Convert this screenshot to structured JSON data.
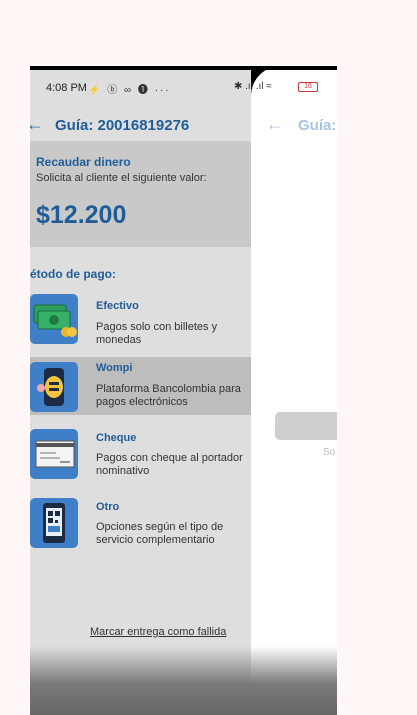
{
  "status": {
    "time": "4:08 PM",
    "icons_left": "⚡ ⓑ ∞ ❶ ···",
    "icons_right": "✱ .ıl .ıl ≈",
    "battery": "16"
  },
  "header": {
    "title": "Guía: 20016819276"
  },
  "amount": {
    "title": "Recaudar dinero",
    "subtitle": "Solicita al cliente el siguiente valor:",
    "value": "$12.200"
  },
  "payment": {
    "section_title": "étodo de pago:",
    "methods": [
      {
        "name": "Efectivo",
        "desc": "Pagos solo con billetes y monedas",
        "icon": "cash-icon"
      },
      {
        "name": "Wompi",
        "desc": "Plataforma Bancolombia para pagos electrónicos",
        "icon": "wompi-phone-icon"
      },
      {
        "name": "Cheque",
        "desc": "Pagos con cheque al portador nominativo",
        "icon": "cheque-icon"
      },
      {
        "name": "Otro",
        "desc": "Opciones según el tipo de servicio complementario",
        "icon": "qr-phone-icon"
      }
    ]
  },
  "fail_link": "Marcar entrega como fallida",
  "right_panel": {
    "title": "Guía:",
    "hint": "So"
  },
  "colors": {
    "accent": "#1f5d98",
    "icon_bg": "#3f7fc8",
    "drawer_bg": "#dedede"
  }
}
